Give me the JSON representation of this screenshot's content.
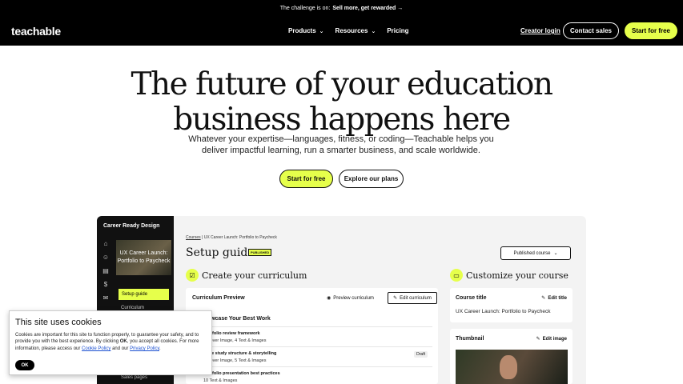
{
  "banner": {
    "prefix": "The challenge is on:",
    "link": "Sell more, get rewarded →"
  },
  "nav": {
    "logo": "teachable",
    "products": "Products",
    "resources": "Resources",
    "pricing": "Pricing",
    "creator_login": "Creator login",
    "contact_sales": "Contact sales",
    "start_free": "Start for free"
  },
  "hero": {
    "title_line1": "The future of your education",
    "title_line2": "business happens here",
    "subtitle": "Whatever your expertise—languages, fitness, or coding—Teachable helps you deliver impactful learning, run a smarter business, and scale worldwide.",
    "start_free": "Start for free",
    "explore_plans": "Explore our plans"
  },
  "app": {
    "sidebar": {
      "title": "Career Ready Design",
      "thumb_text": "UX Career Launch: Portfolio to Paycheck",
      "setup_guide": "Setup guide",
      "curriculum": "Curriculum",
      "sales_pages": "Sales pages"
    },
    "breadcrumb": {
      "courses": "Courses",
      "sep": "|",
      "current": "UX Career Launch: Portfolio to Paycheck"
    },
    "title": "Setup guide",
    "status_tag": "PUBLISHED",
    "status_select": "Published course",
    "create_curriculum": "Create your curriculum",
    "customize_course": "Customize your course",
    "curriculum_preview": {
      "label": "Curriculum Preview",
      "preview_button": "Preview curriculum",
      "edit_button": "Edit curriculum",
      "stage": "Showcase Your Best Work",
      "rows": [
        {
          "title": "Portfolio review framework",
          "sub": "1 Cover Image, 4 Text & Images",
          "badge": ""
        },
        {
          "title": "Case study structure & storytelling",
          "sub": "1 Cover Image, 5 Text & Images",
          "badge": "Draft"
        },
        {
          "title": "Portfolio presentation best practices",
          "sub": "10 Text & Images",
          "badge": ""
        }
      ]
    },
    "course_title": {
      "label": "Course title",
      "edit": "Edit title",
      "value": "UX Career Launch: Portfolio to Paycheck"
    },
    "thumbnail": {
      "label": "Thumbnail",
      "edit": "Edit image"
    }
  },
  "cookie": {
    "title": "This site uses cookies",
    "body_1": "Cookies are important for this site to function properly, to guarantee your safety, and to provide you with the best experience. By clicking",
    "ok_word": "OK",
    "body_2": ", you accept all cookies. For more information, please access our",
    "cookie_policy": "Cookie Policy",
    "and": "and our",
    "privacy_policy": "Privacy Policy",
    "ok_button": "OK"
  },
  "colors": {
    "accent": "#e6ff4b",
    "dark": "#000000"
  }
}
